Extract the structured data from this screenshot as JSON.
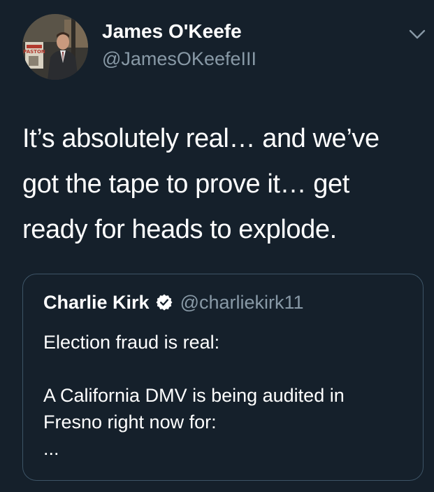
{
  "tweet": {
    "author": {
      "display_name": "James O'Keefe",
      "handle": "@JamesOKeefeIII",
      "avatar_icon": "profile-photo",
      "avatar_sign_text": "PASTON"
    },
    "menu_icon": "chevron-down-icon",
    "text_lines": [
      "It’s absolutely real… and we’ve",
      "got the tape to prove it… get",
      "ready for heads to explode."
    ]
  },
  "quoted_tweet": {
    "author": {
      "display_name": "Charlie Kirk",
      "handle": "@charliekirk11",
      "verified_icon": "verified-badge-icon"
    },
    "text_lines": [
      "Election fraud is real:",
      "",
      "A California DMV is being audited in",
      "Fresno right now for:",
      "..."
    ]
  },
  "colors": {
    "background": "#15202b",
    "text_primary": "#ffffff",
    "text_secondary": "#8899a6",
    "card_border": "#3d5466"
  }
}
